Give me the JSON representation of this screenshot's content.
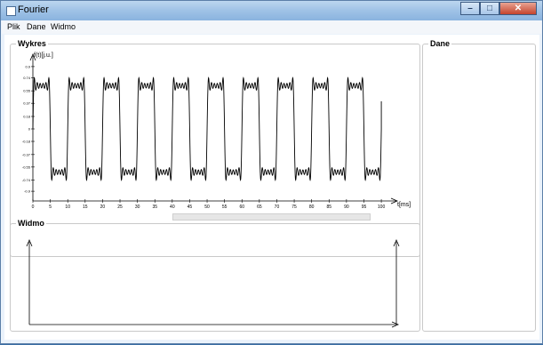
{
  "window": {
    "title": "Fourier"
  },
  "menu": [
    "Plik",
    "Dane",
    "Widmo"
  ],
  "panels": {
    "wykres": "Wykres",
    "widmo": "Widmo",
    "dane": "Dane"
  },
  "colors": {
    "line": "#000000",
    "titlebar": "#9fc2e6",
    "close": "#c5432d"
  },
  "chart_data": {
    "type": "line",
    "title": "Wykres",
    "ylabel": "f(t)[j.u.]",
    "xlabel": "t[ms]",
    "xlim": [
      0,
      101
    ],
    "ylim": [
      -0.95,
      0.95
    ],
    "x_ticks": [
      0,
      5,
      10,
      15,
      20,
      25,
      30,
      35,
      40,
      45,
      50,
      55,
      60,
      65,
      70,
      75,
      80,
      85,
      90,
      95,
      100
    ],
    "y_ticks": [
      0.9,
      0.74,
      0.55,
      0.37,
      0.18,
      0,
      -0.18,
      -0.37,
      -0.55,
      -0.74,
      -0.9
    ],
    "series": [
      {
        "waveform": "square (Fourier partial sum, Gibbs ripple)",
        "period_ms": 10,
        "amplitude": 0.8,
        "harmonics": 11,
        "x_range": [
          0,
          100
        ]
      }
    ],
    "grid": false
  }
}
